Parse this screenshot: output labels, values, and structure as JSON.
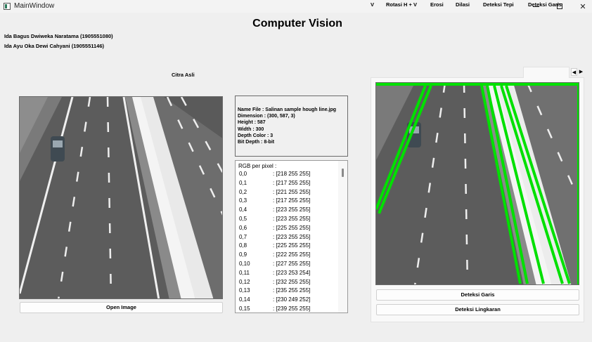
{
  "window": {
    "title": "MainWindow",
    "controls": {
      "minimize": "",
      "maximize": "",
      "close": "✕"
    }
  },
  "header": {
    "title": "Computer Vision",
    "authors": [
      "Ida Bagus Dwiweka Naratama (1905551080)",
      "Ida Ayu Oka Dewi Cahyani (1905551146)"
    ]
  },
  "original": {
    "label": "Citra Asli",
    "open_button": "Open Image"
  },
  "info": {
    "lines": [
      "Name File : Salinan sample hough line.jpg",
      "Dimension : (300, 587, 3)",
      "Height : 587",
      "Width : 300",
      "Depth Color : 3",
      "Bit Depth : 8-bit"
    ]
  },
  "rgb": {
    "header": "RGB per pixel :",
    "rows": [
      {
        "k": "0,0",
        "v": ": [218 255 255]"
      },
      {
        "k": "0,1",
        "v": ": [217 255 255]"
      },
      {
        "k": "0,2",
        "v": ": [221 255 255]"
      },
      {
        "k": "0,3",
        "v": ": [217 255 255]"
      },
      {
        "k": "0,4",
        "v": ": [223 255 255]"
      },
      {
        "k": "0,5",
        "v": ": [223 255 255]"
      },
      {
        "k": "0,6",
        "v": ": [225 255 255]"
      },
      {
        "k": "0,7",
        "v": ": [223 255 255]"
      },
      {
        "k": "0,8",
        "v": ": [225 255 255]"
      },
      {
        "k": "0,9",
        "v": ": [222 255 255]"
      },
      {
        "k": "0,10",
        "v": ": [227 255 255]"
      },
      {
        "k": "0,11",
        "v": ": [223 253 254]"
      },
      {
        "k": "0,12",
        "v": ": [232 255 255]"
      },
      {
        "k": "0,13",
        "v": ": [235 255 255]"
      },
      {
        "k": "0,14",
        "v": ": [230 249 252]"
      },
      {
        "k": "0,15",
        "v": ": [239 255 255]"
      }
    ]
  },
  "tabs": {
    "items": [
      "V",
      "Rotasi H + V",
      "Erosi",
      "Dilasi",
      "Deteksi Tepi",
      "Deteksi Garis"
    ],
    "active": "Deteksi Garis",
    "scroll_left": "◀",
    "scroll_right": "▶"
  },
  "result": {
    "garis_button": "Deteksi Garis",
    "lingkaran_button": "Deteksi Lingkaran"
  },
  "colors": {
    "detected_line": "#00e000",
    "road": "#5e5e5e"
  }
}
